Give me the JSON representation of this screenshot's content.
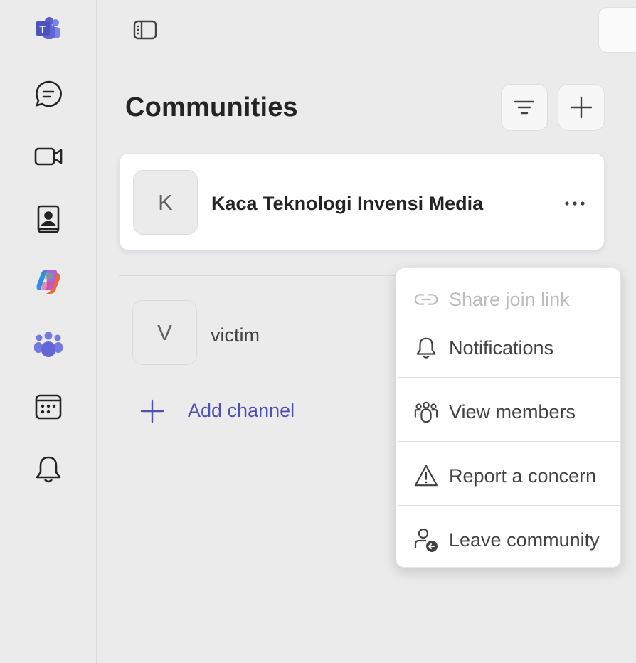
{
  "rail": {
    "items": [
      {
        "name": "teams-app-icon"
      },
      {
        "name": "chat-icon"
      },
      {
        "name": "meet-video-icon"
      },
      {
        "name": "contacts-icon"
      },
      {
        "name": "copilot-icon"
      },
      {
        "name": "communities-icon"
      },
      {
        "name": "calendar-icon"
      },
      {
        "name": "activity-bell-icon"
      }
    ]
  },
  "header": {
    "title": "Communities",
    "filter_icon": "filter-icon",
    "add_icon": "plus-icon"
  },
  "community": {
    "initial": "K",
    "name": "Kaca Teknologi Invensi Media",
    "more_icon": "more-options-icon"
  },
  "channels": [
    {
      "initial": "V",
      "name": "victim"
    }
  ],
  "add_channel": {
    "label": "Add channel"
  },
  "context_menu": {
    "items": [
      {
        "label": "Share join link",
        "icon": "link-icon",
        "disabled": true
      },
      {
        "label": "Notifications",
        "icon": "bell-icon",
        "disabled": false
      },
      {
        "label": "View members",
        "icon": "members-icon",
        "disabled": false
      },
      {
        "label": "Report a concern",
        "icon": "warning-icon",
        "disabled": false
      },
      {
        "label": "Leave community",
        "icon": "leave-person-icon",
        "disabled": false
      }
    ]
  },
  "colors": {
    "accent": "#4f52b2",
    "rail_background": "#ebebeb",
    "teams_purple": "#5b5fc7"
  }
}
